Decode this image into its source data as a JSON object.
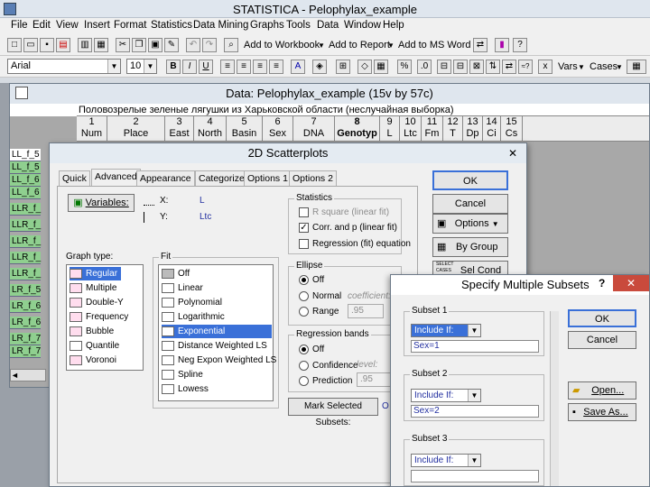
{
  "app": {
    "title": "STATISTICA - Pelophylax_example"
  },
  "menu": [
    "File",
    "Edit",
    "View",
    "Insert",
    "Format",
    "Statistics",
    "Data Mining",
    "Graphs",
    "Tools",
    "Data",
    "Window",
    "Help"
  ],
  "toolbar1": {
    "add_workbook": "Add to Workbook",
    "add_report": "Add to Report",
    "add_msword": "Add to MS Word"
  },
  "toolbar2": {
    "font": "Arial",
    "size": "10",
    "vars": "Vars",
    "cases": "Cases"
  },
  "datawin": {
    "title": "Data: Pelophylax_example (15v by 57c)",
    "subtitle": "Половозрелые зеленые лягушки из Харьковской области (неслучайная выборка)",
    "columns": [
      {
        "n": "1",
        "name": "Num"
      },
      {
        "n": "2",
        "name": "Place"
      },
      {
        "n": "3",
        "name": "East"
      },
      {
        "n": "4",
        "name": "North"
      },
      {
        "n": "5",
        "name": "Basin"
      },
      {
        "n": "6",
        "name": "Sex"
      },
      {
        "n": "7",
        "name": "DNA"
      },
      {
        "n": "8",
        "name": "Genotyp"
      },
      {
        "n": "9",
        "name": "L"
      },
      {
        "n": "10",
        "name": "Ltc"
      },
      {
        "n": "11",
        "name": "Fm"
      },
      {
        "n": "12",
        "name": "T"
      },
      {
        "n": "13",
        "name": "Dp"
      },
      {
        "n": "14",
        "name": "Ci"
      },
      {
        "n": "15",
        "name": "Cs"
      }
    ],
    "rows": [
      "LL_f_5",
      "LL_f_5",
      "LL_f_6",
      "LL_f_6",
      "LLR_f_",
      "LLR_f_",
      "LLR_f_",
      "LLR_f_",
      "LLR_f_",
      "LR_f_5",
      "LR_f_6",
      "LR_f_6",
      "LR_f_7",
      "LR_f_7"
    ]
  },
  "scatter": {
    "title": "2D Scatterplots",
    "tabs": [
      "Quick",
      "Advanced",
      "Appearance",
      "Categorized",
      "Options 1",
      "Options 2"
    ],
    "variables_btn": "Variables:",
    "x_label": "X:",
    "x_value": "L",
    "y_label": "Y:",
    "y_value": "Ltc",
    "statistics_label": "Statistics",
    "stat_items": [
      "R square (linear fit)",
      "Corr. and p (linear fit)",
      "Regression (fit) equation"
    ],
    "graph_type_label": "Graph type:",
    "graph_types": [
      "Regular",
      "Multiple",
      "Double-Y",
      "Frequency",
      "Bubble",
      "Quantile",
      "Voronoi"
    ],
    "fit_label": "Fit",
    "fits": [
      "Off",
      "Linear",
      "Polynomial",
      "Logarithmic",
      "Exponential",
      "Distance Weighted LS",
      "Neg Expon Weighted LS",
      "Spline",
      "Lowess"
    ],
    "ellipse_label": "Ellipse",
    "ellipse_items": [
      "Off",
      "Normal",
      "Range"
    ],
    "coefficient_label": "coefficient:",
    "coefficient_value": ".95",
    "bands_label": "Regression bands",
    "band_items": [
      "Off",
      "Confidence",
      "Prediction"
    ],
    "level_label": "level:",
    "level_value": ".95",
    "mark_btn": "Mark Selected Subsets:",
    "mark_tail": "O",
    "ok": "OK",
    "cancel": "Cancel",
    "options": "Options",
    "bygroup": "By Group",
    "selcond": "Sel Cond",
    "select_cases": "SELECT CASES"
  },
  "subsets": {
    "title": "Specify Multiple Subsets",
    "help": "?",
    "close": "✕",
    "groups": [
      {
        "label": "Subset 1",
        "mode": "Include If:",
        "expr": "Sex=1"
      },
      {
        "label": "Subset 2",
        "mode": "Include If:",
        "expr": "Sex=2"
      },
      {
        "label": "Subset 3",
        "mode": "Include If:",
        "expr": ""
      }
    ],
    "ok": "OK",
    "cancel": "Cancel",
    "open": "Open...",
    "saveas": "Save As..."
  }
}
